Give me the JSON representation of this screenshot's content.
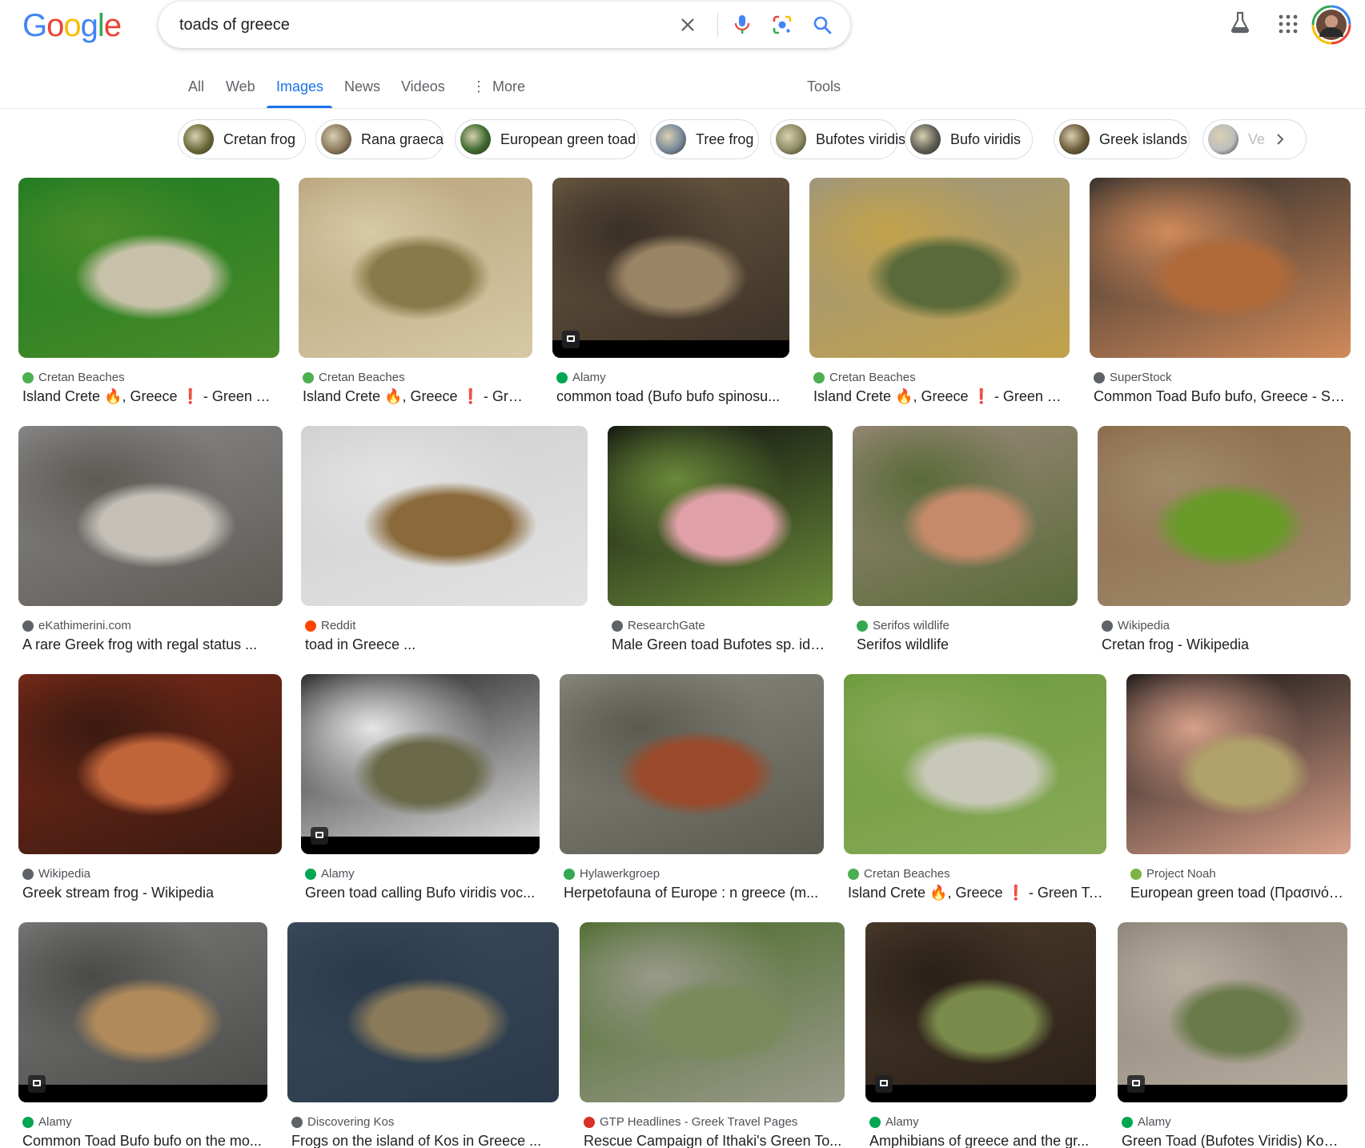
{
  "logo": "Google",
  "search": {
    "query": "toads of greece",
    "clear_label": "Clear",
    "voice_label": "Search by voice",
    "lens_label": "Search by image",
    "submit_label": "Search"
  },
  "tabs": [
    {
      "label": "All",
      "active": false
    },
    {
      "label": "Web",
      "active": false
    },
    {
      "label": "Images",
      "active": true
    },
    {
      "label": "News",
      "active": false
    },
    {
      "label": "Videos",
      "active": false
    },
    {
      "label": "More",
      "active": false
    }
  ],
  "tools_label": "Tools",
  "chips": [
    {
      "label": "Cretan frog",
      "color": "#6b6a3a"
    },
    {
      "label": "Rana graeca",
      "color": "#8b7a5e"
    },
    {
      "label": "European green toad",
      "color": "#3e6b2e"
    },
    {
      "label": "Tree frog",
      "color": "#7a8a9c"
    },
    {
      "label": "Bufotes viridis",
      "color": "#8c8a63"
    },
    {
      "label": "Bufo viridis",
      "color": "#5e5e55"
    },
    {
      "label": "Greek islands",
      "color": "#6a5a3a"
    },
    {
      "label": "Ve",
      "color": "#bdbdbd"
    }
  ],
  "results": [
    {
      "source": "Cretan Beaches",
      "title": "Island Crete 🔥, Greece ❗ - Green Toad",
      "favicon_color": "#4caf50",
      "colors": [
        "#1e7a22",
        "#c7c1a9",
        "#4a8c2a"
      ],
      "stock": false
    },
    {
      "source": "Cretan Beaches",
      "title": "Island Crete 🔥, Greece ❗ - Green...",
      "favicon_color": "#4caf50",
      "colors": [
        "#b8a27a",
        "#8a7a4a",
        "#d6c9a5"
      ],
      "stock": false
    },
    {
      "source": "Alamy",
      "title": "common toad (Bufo bufo spinosu...",
      "favicon_color": "#00a651",
      "colors": [
        "#6b5a42",
        "#9a8466",
        "#3a3026"
      ],
      "stock": true
    },
    {
      "source": "Cretan Beaches",
      "title": "Island Crete 🔥, Greece ❗ - Green Toad",
      "favicon_color": "#4caf50",
      "colors": [
        "#9a9482",
        "#5a6a3a",
        "#c2a24a"
      ],
      "stock": false
    },
    {
      "source": "SuperStock",
      "title": "Common Toad Bufo bufo, Greece - Su...",
      "favicon_color": "#5f6368",
      "colors": [
        "#2a2a2a",
        "#b06a3a",
        "#d08a5a"
      ],
      "stock": false
    },
    {
      "source": "eKathimerini.com",
      "title": "A rare Greek frog with regal status ...",
      "favicon_color": "#5f6368",
      "colors": [
        "#8a8a8a",
        "#c4c0b8",
        "#5e5a55"
      ],
      "stock": false
    },
    {
      "source": "Reddit",
      "title": "toad in Greece ...",
      "favicon_color": "#ff4500",
      "colors": [
        "#cfcfcf",
        "#8a6a3a",
        "#e2e2e2"
      ],
      "stock": false
    },
    {
      "source": "ResearchGate",
      "title": "Male Green toad Bufotes sp. ide...",
      "favicon_color": "#5f6368",
      "colors": [
        "#0e0e0e",
        "#e0a0a8",
        "#6a8a3a"
      ],
      "stock": false
    },
    {
      "source": "Serifos wildlife",
      "title": "Serifos wildlife",
      "favicon_color": "#34a853",
      "colors": [
        "#9a8a7a",
        "#c48a6a",
        "#5a6a3a"
      ],
      "stock": false
    },
    {
      "source": "Wikipedia",
      "title": "Cretan frog - Wikipedia",
      "favicon_color": "#5f6368",
      "colors": [
        "#8a6a4a",
        "#6a9a2a",
        "#a08a6a"
      ],
      "stock": false
    },
    {
      "source": "Wikipedia",
      "title": "Greek stream frog - Wikipedia",
      "favicon_color": "#5f6368",
      "colors": [
        "#7a2a1a",
        "#c0643a",
        "#3a1a10"
      ],
      "stock": false
    },
    {
      "source": "Alamy",
      "title": "Green toad calling Bufo viridis voc...",
      "favicon_color": "#00a651",
      "colors": [
        "#1a1a1a",
        "#6a6a4a",
        "#e6e6e6"
      ],
      "stock": true
    },
    {
      "source": "Hylawerkgroep",
      "title": "Herpetofauna of Europe : n greece (m...",
      "favicon_color": "#34a853",
      "colors": [
        "#8a8a80",
        "#9a4a2a",
        "#5a5a50"
      ],
      "stock": false
    },
    {
      "source": "Cretan Beaches",
      "title": "Island Crete 🔥, Greece ❗ - Green Toad",
      "favicon_color": "#4caf50",
      "colors": [
        "#6a9a3a",
        "#c8c8b8",
        "#8aaa5a"
      ],
      "stock": false
    },
    {
      "source": "Project Noah",
      "title": "European green toad (Πρασινόφ...",
      "favicon_color": "#7cb342",
      "colors": [
        "#0e0e0e",
        "#b0a06a",
        "#d8a08a"
      ],
      "stock": false
    },
    {
      "source": "Alamy",
      "title": "Common Toad Bufo bufo on the mo...",
      "favicon_color": "#00a651",
      "colors": [
        "#7a7a78",
        "#b08a5a",
        "#4a4a48"
      ],
      "stock": true
    },
    {
      "source": "Discovering Kos",
      "title": "Frogs on the island of Kos in Greece ...",
      "favicon_color": "#5f6368",
      "colors": [
        "#3a4a5a",
        "#8a7a5a",
        "#2a3a4a"
      ],
      "stock": false
    },
    {
      "source": "GTP Headlines - Greek Travel Pages",
      "title": "Rescue Campaign of Ithaki's Green To...",
      "favicon_color": "#d93025",
      "colors": [
        "#4a6a2a",
        "#7a8a5a",
        "#9a9a8a"
      ],
      "stock": false
    },
    {
      "source": "Alamy",
      "title": "Amphibians of greece and the gr...",
      "favicon_color": "#00a651",
      "colors": [
        "#4a3a2a",
        "#7a8a4a",
        "#2a2018"
      ],
      "stock": true
    },
    {
      "source": "Alamy",
      "title": "Green Toad (Bufotes Viridis) Kos ...",
      "favicon_color": "#00a651",
      "colors": [
        "#8a8278",
        "#6a7a4a",
        "#b8aea0"
      ],
      "stock": true
    }
  ]
}
